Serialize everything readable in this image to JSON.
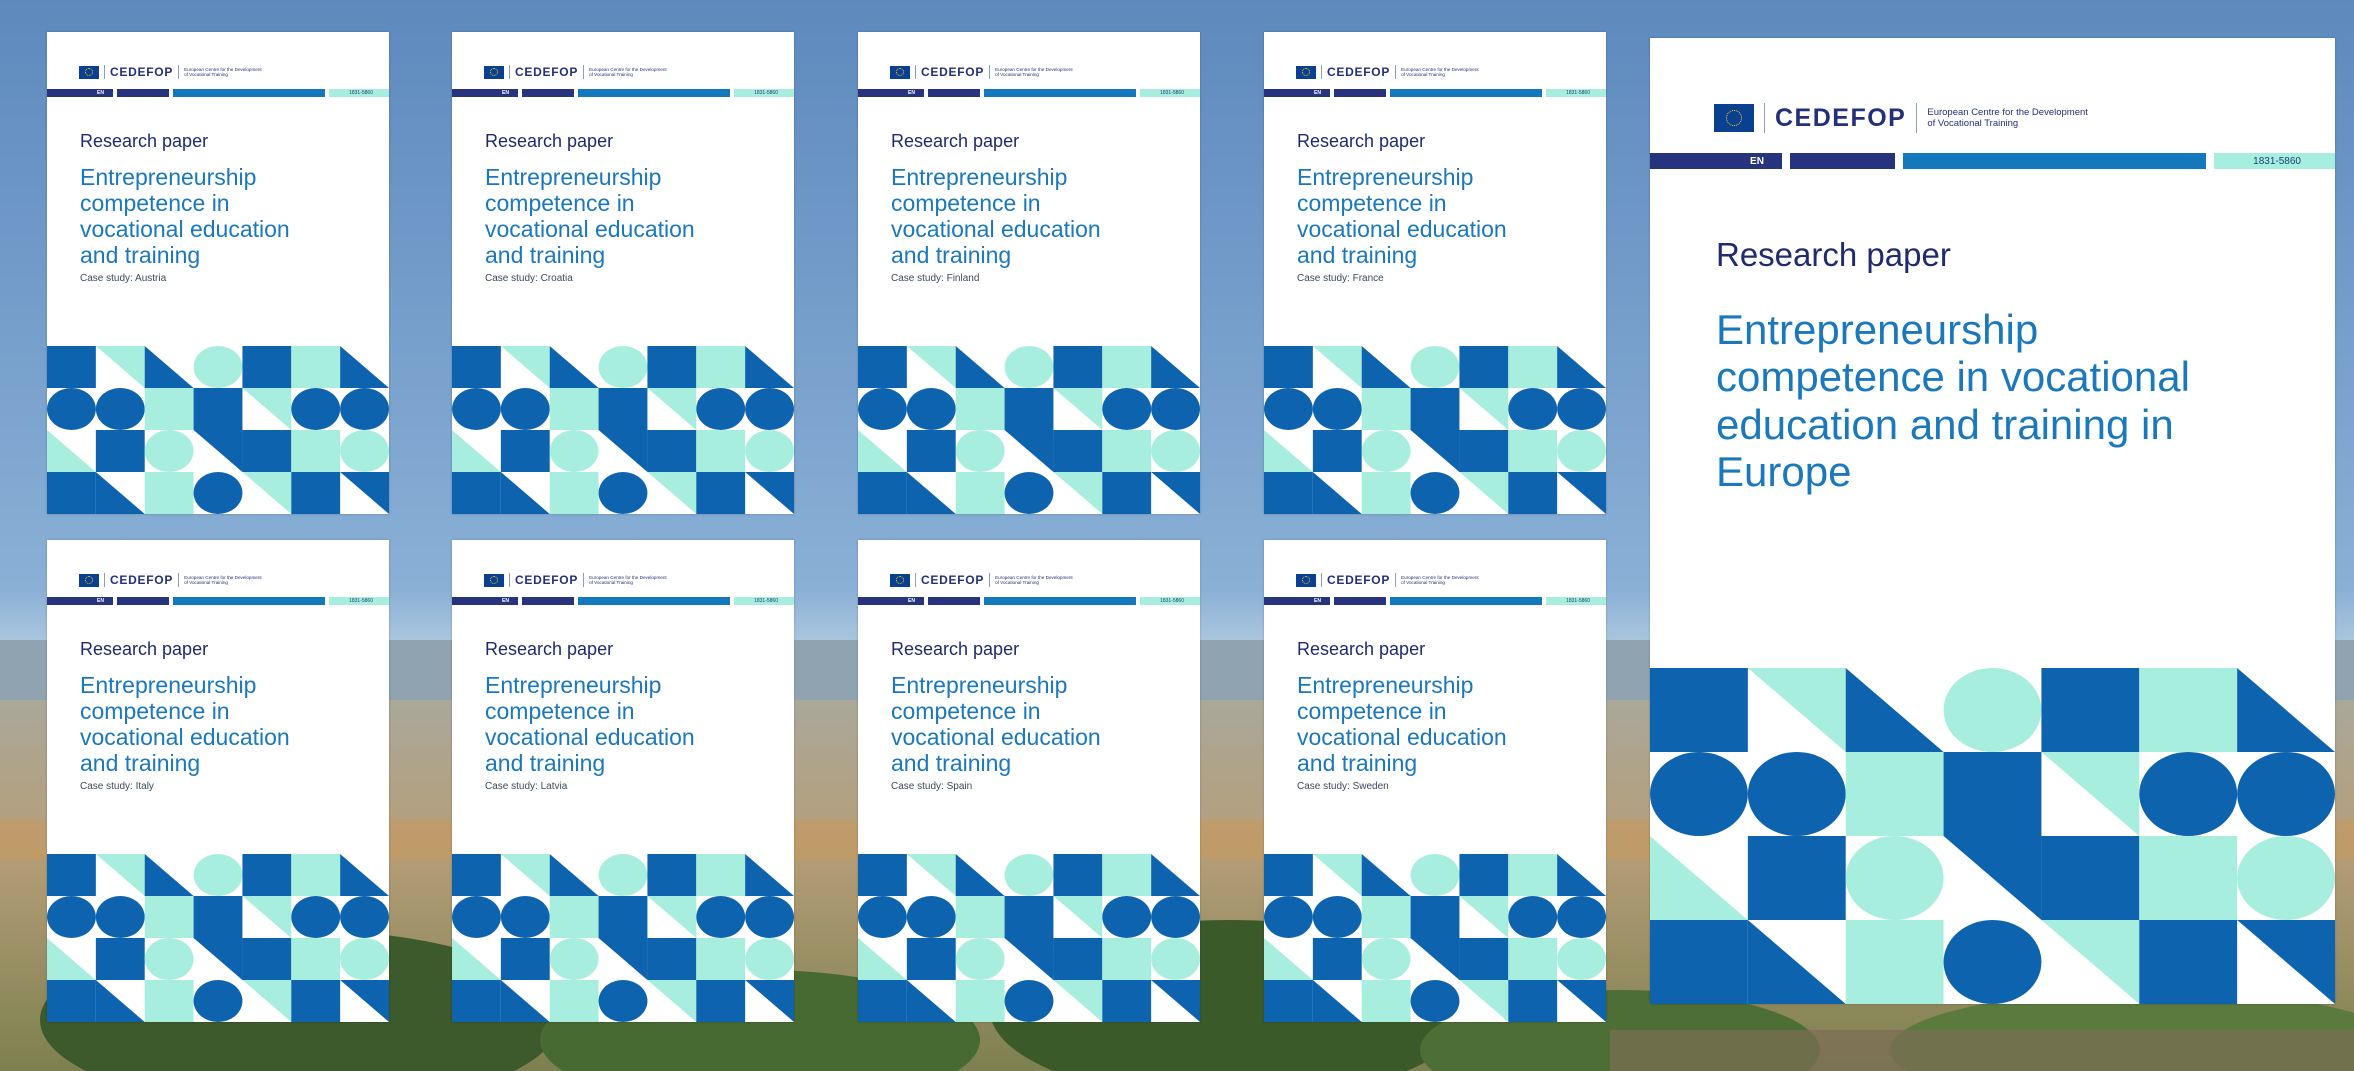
{
  "colors": {
    "dark_blue": "#0e63ae",
    "teal": "#a8eedf",
    "navy": "#24307a",
    "title_blue": "#1a78bd",
    "sky": "#6d95c1"
  },
  "icons": [
    "eu-flag-icon",
    "cedefop-logo"
  ],
  "featured_cover": {
    "logo_text": "CEDEFOP",
    "agency_line1": "European Centre for the Development",
    "agency_line2": "of Vocational Training",
    "language": "EN",
    "issn": "1831-5860",
    "label": "Research paper",
    "title": "Entrepreneurship competence in vocational education and training in Europe"
  },
  "case_study_covers": [
    {
      "label": "Research paper",
      "title": "Entrepreneurship competence in vocational education and training",
      "case": "Case study: Austria"
    },
    {
      "label": "Research paper",
      "title": "Entrepreneurship competence in vocational education and training",
      "case": "Case study: Croatia"
    },
    {
      "label": "Research paper",
      "title": "Entrepreneurship competence in vocational education and training",
      "case": "Case study: Finland"
    },
    {
      "label": "Research paper",
      "title": "Entrepreneurship competence in vocational education and training",
      "case": "Case study: France"
    },
    {
      "label": "Research paper",
      "title": "Entrepreneurship competence in vocational education and training",
      "case": "Case study: Italy"
    },
    {
      "label": "Research paper",
      "title": "Entrepreneurship competence in vocational education and training",
      "case": "Case study: Latvia"
    },
    {
      "label": "Research paper",
      "title": "Entrepreneurship competence in vocational education and training",
      "case": "Case study: Spain"
    },
    {
      "label": "Research paper",
      "title": "Entrepreneurship competence in vocational education and training",
      "case": "Case study: Sweden"
    }
  ]
}
